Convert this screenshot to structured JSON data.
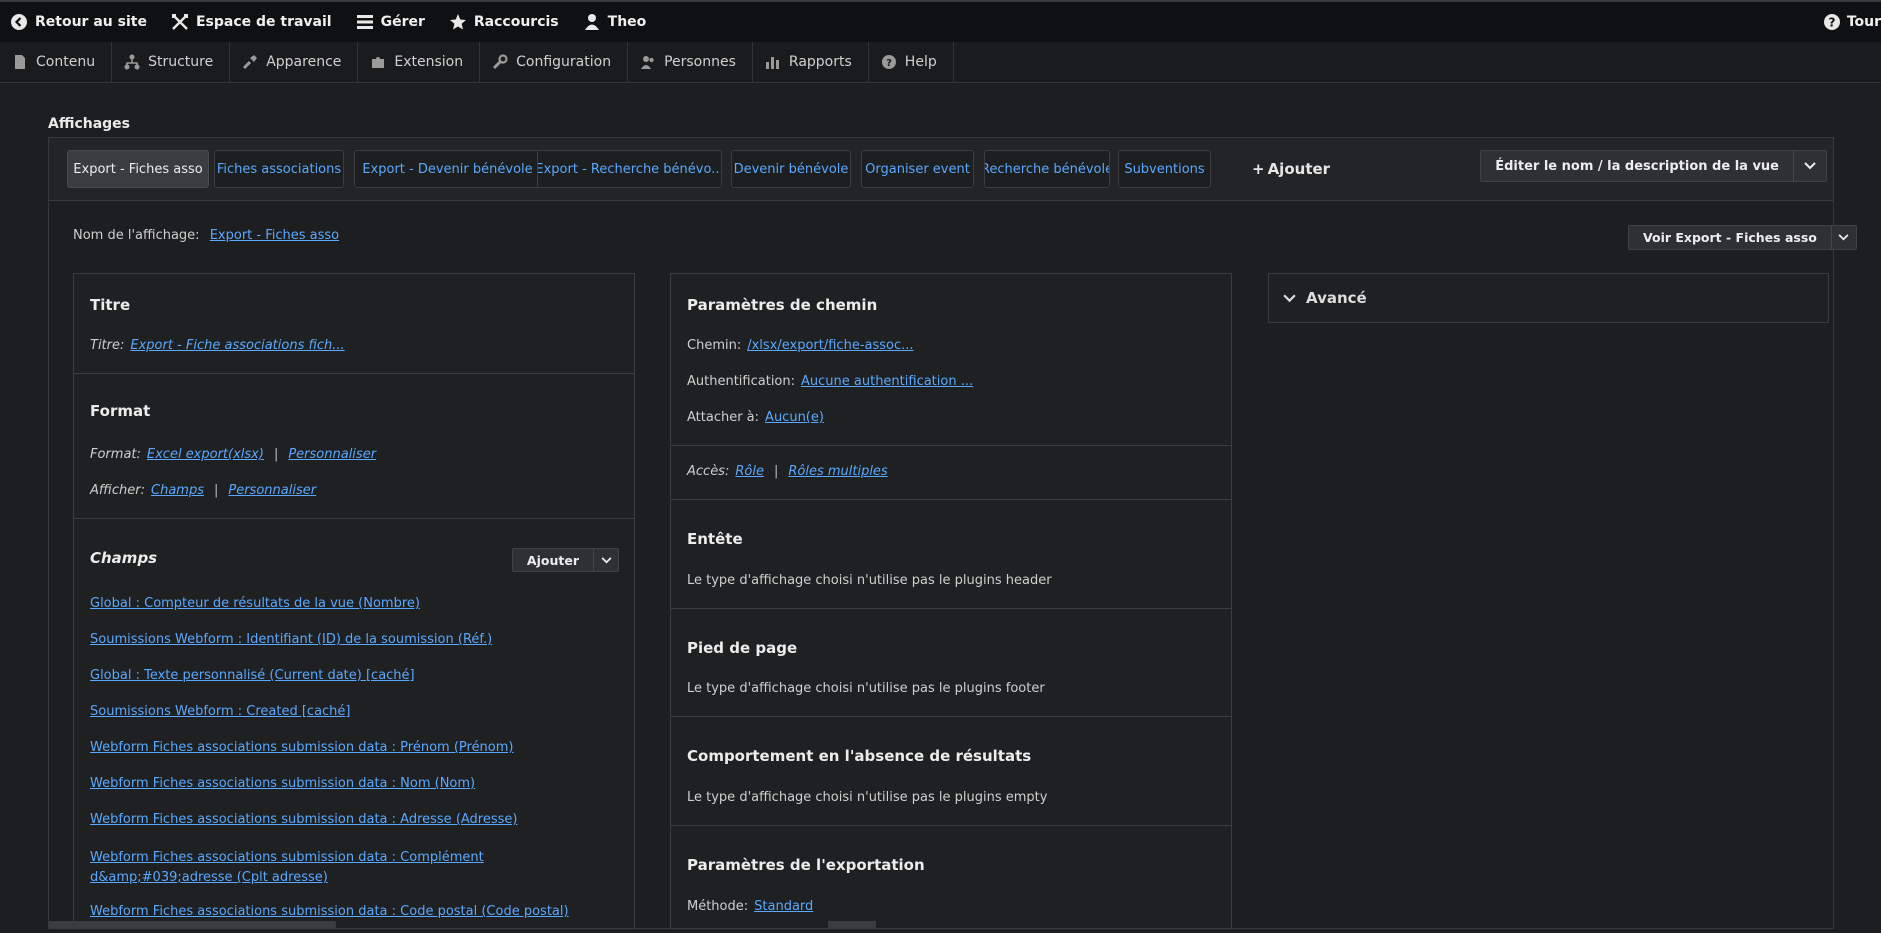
{
  "admin_toolbar": {
    "back_to_site": "Retour au site",
    "workspace": "Espace de travail",
    "manage": "Gérer",
    "shortcuts": "Raccourcis",
    "user": "Theo",
    "tour": "Tour"
  },
  "admin_menu": [
    "Contenu",
    "Structure",
    "Apparence",
    "Extension",
    "Configuration",
    "Personnes",
    "Rapports",
    "Help"
  ],
  "displays": {
    "title": "Affichages",
    "tabs": [
      "Export - Fiches asso",
      "Fiches associations",
      "Export - Devenir bénévole",
      "Export - Recherche bénévo...",
      "Devenir bénévole",
      "Organiser event",
      "Recherche bénévole",
      "Subventions"
    ],
    "add_label": "Ajouter",
    "edit_view_label": "Éditer le nom / la description de la vue"
  },
  "display_name": {
    "label": "Nom de l'affichage:",
    "value": "Export - Fiches asso",
    "view_button": "Voir Export - Fiches asso"
  },
  "left_column": {
    "title_section": {
      "heading": "Titre",
      "label": "Titre:",
      "value": "Export - Fiche associations fich..."
    },
    "format_section": {
      "heading": "Format",
      "format_label": "Format:",
      "format_value": "Excel export(xlsx)",
      "format_custom": "Personnaliser",
      "show_label": "Afficher:",
      "show_value": "Champs",
      "show_custom": "Personnaliser"
    },
    "fields_section": {
      "heading": "Champs",
      "add_label": "Ajouter",
      "fields": [
        "Global : Compteur de résultats de la vue (Nombre)",
        "Soumissions Webform : Identifiant (ID) de la soumission (Réf.)",
        "Global : Texte personnalisé (Current date) [caché]",
        "Soumissions Webform : Created [caché]",
        "Webform Fiches associations submission data : Prénom (Prénom)",
        "Webform Fiches associations submission data : Nom (Nom)",
        "Webform Fiches associations submission data : Adresse (Adresse)",
        "Webform Fiches associations submission data : Complément d&amp;#039;adresse (Cplt adresse)",
        "Webform Fiches associations submission data : Code postal (Code postal)"
      ]
    }
  },
  "middle_column": {
    "path_section": {
      "heading": "Paramètres de chemin",
      "path_label": "Chemin:",
      "path_value": "/xlsx/export/fiche-assoc...",
      "auth_label": "Authentification:",
      "auth_value": "Aucune authentification ...",
      "attach_label": "Attacher à:",
      "attach_value": "Aucun(e)"
    },
    "access": {
      "label": "Accès:",
      "value": "Rôle",
      "value2": "Rôles multiples"
    },
    "header_section": {
      "heading": "Entête",
      "text": "Le type d'affichage choisi n'utilise pas le plugins header"
    },
    "footer_section": {
      "heading": "Pied de page",
      "text": "Le type d'affichage choisi n'utilise pas le plugins footer"
    },
    "empty_section": {
      "heading": "Comportement en l'absence de résultats",
      "text": "Le type d'affichage choisi n'utilise pas le plugins empty"
    },
    "export_section": {
      "heading": "Paramètres de l'exportation",
      "method_label": "Méthode:",
      "method_value": "Standard"
    }
  },
  "advanced": {
    "label": "Avancé"
  }
}
